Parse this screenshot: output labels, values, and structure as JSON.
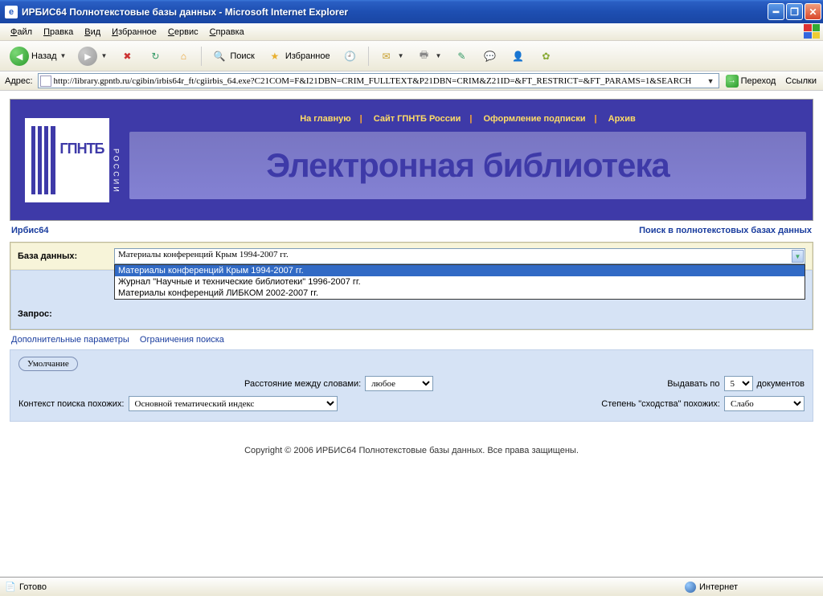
{
  "window": {
    "title": "ИРБИС64 Полнотекстовые базы данных - Microsoft Internet Explorer"
  },
  "menu": {
    "file": "Файл",
    "edit": "Правка",
    "view": "Вид",
    "favorites": "Избранное",
    "service": "Сервис",
    "help": "Справка"
  },
  "toolbar": {
    "back": "Назад",
    "search": "Поиск",
    "favorites": "Избранное"
  },
  "address": {
    "label": "Адрес:",
    "url": "http://library.gpntb.ru/cgibin/irbis64r_ft/cgiirbis_64.exe?C21COM=F&I21DBN=CRIM_FULLTEXT&P21DBN=CRIM&Z21ID=&FT_RESTRICT=&FT_PARAMS=1&SEARCH",
    "go": "Переход",
    "links": "Ссылки"
  },
  "banner": {
    "logo_text": "ГПНТБ",
    "logo_sub": "РОССИИ",
    "nav": {
      "home": "На главную",
      "site": "Сайт ГПНТБ России",
      "subscribe": "Оформление подписки",
      "archive": "Архив"
    },
    "title": "Электронная библиотека"
  },
  "breadcrumb": {
    "left": "Ирбис64",
    "right": "Поиск в полнотекстовых базах данных"
  },
  "form": {
    "db_label": "База данных:",
    "db_selected": "Материалы конференций Крым 1994-2007 гг.",
    "db_options": [
      "Материалы конференций Крым 1994-2007 гг.",
      "Журнал \"Научные и технические библиотеки\" 1996-2007 гг.",
      "Материалы конференций ЛИБКОМ 2002-2007 гг."
    ],
    "query_label": "Запрос:",
    "more_params": "Дополнительные параметры",
    "restrict": "Ограничения поиска",
    "default_btn": "Умолчание",
    "distance_label": "Расстояние между словами:",
    "distance_value": "любое",
    "count_label_pre": "Выдавать по",
    "count_value": "5",
    "count_label_post": "документов",
    "context_label": "Контекст поиска похожих:",
    "context_value": "Основной тематический индекс",
    "similar_label": "Степень \"сходства\" похожих:",
    "similar_value": "Слабо"
  },
  "footer": "Copyright © 2006 ИРБИС64 Полнотекстовые базы данных. Все права защищены.",
  "status": {
    "ready": "Готово",
    "zone": "Интернет"
  }
}
